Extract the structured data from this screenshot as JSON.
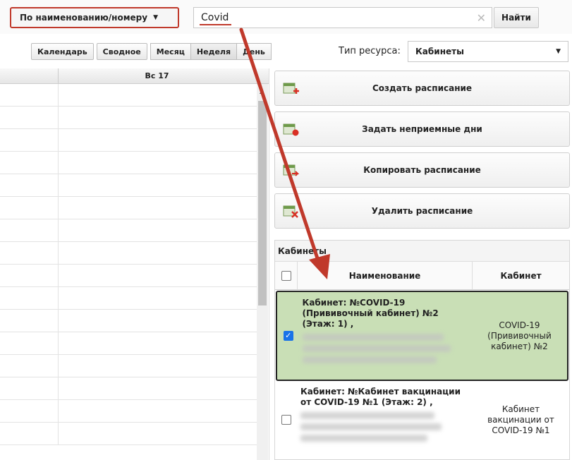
{
  "search": {
    "mode_label": "По наименованию/номеру",
    "query": "Covid",
    "find_label": "Найти"
  },
  "views": {
    "calendar": "Календарь",
    "summary": "Сводное",
    "month": "Месяц",
    "week": "Неделя",
    "day": "День",
    "active": "week"
  },
  "resource": {
    "label": "Тип ресурса:",
    "selected": "Кабинеты"
  },
  "calendar": {
    "day_header": "Вс 17"
  },
  "actions": {
    "create": "Создать расписание",
    "nonworking": "Задать неприемные дни",
    "copy": "Копировать расписание",
    "delete": "Удалить расписание"
  },
  "cabinets": {
    "title": "Кабинеты",
    "col_name": "Наименование",
    "col_cabinet": "Кабинет",
    "rows": [
      {
        "name": "Кабинет: №COVID-19 (Прививочный кабинет) №2 (Этаж: 1) ,",
        "cabinet": "COVID-19 (Прививочный кабинет) №2",
        "checked": true
      },
      {
        "name": "Кабинет: №Кабинет вакцинации от COVID-19 №1 (Этаж: 2) ,",
        "cabinet": "Кабинет вакцинации от COVID-19 №1",
        "checked": false
      }
    ]
  },
  "colors": {
    "highlight": "#c0392b",
    "selected_row": "#c9dfb6",
    "checkbox": "#1a73e8"
  }
}
